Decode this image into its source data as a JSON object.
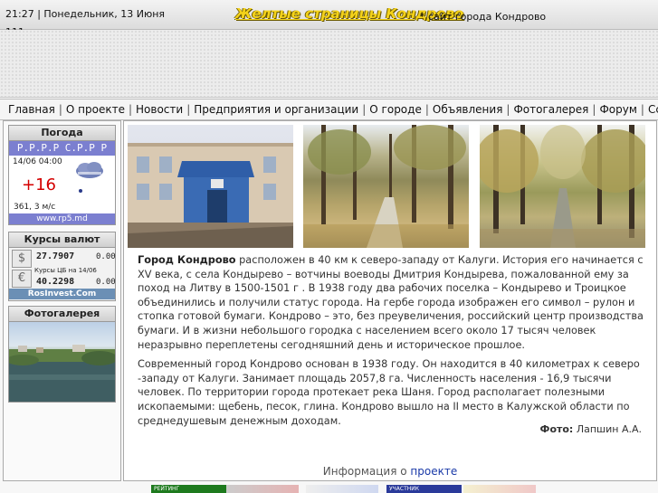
{
  "header": {
    "clock": "21:27 | Понедельник, 13 Июня 111",
    "logo": "Желтые страницы Кондрово",
    "tagline": "* сайт города Кондрово"
  },
  "nav": {
    "items": [
      "Главная",
      "О проекте",
      "Новости",
      "Предприятия и организации",
      "О городе",
      "Объявления",
      "Фотогалерея",
      "Форум",
      "Ссылки"
    ],
    "separator": "|"
  },
  "sidebar": {
    "weather": {
      "title": "Погода",
      "city": "Р.Р.Р.Р С.Р.Р Р",
      "date": "14/06 04:00",
      "temp": "+16",
      "wind": "361, 3 м/с",
      "site": "www.rp5.md"
    },
    "currency": {
      "title": "Курсы валют",
      "usd_symbol": "$",
      "usd_value": "27.7907",
      "usd_change": "0.00",
      "note": "Курсы ЦБ на   14/06",
      "eur_symbol": "€",
      "eur_value": "40.2298",
      "eur_change": "0.00",
      "site": "RosInvest.Com"
    },
    "gallery": {
      "title": "Фотогалерея"
    }
  },
  "main": {
    "lead": "Город Кондрово",
    "paragraph1": " расположен в 40 км к северо-западу от Калуги. История его начинается с XV века, с села Кондырево – вотчины воеводы Дмитрия Кондырева, пожалованной ему за поход на Литву в 1500-1501 г . В 1938 году два рабочих поселка – Кондырево и Троицкое объединились и получили статус города. На гербе города изображен его символ – рулон и стопка готовой бумаги. Кондрово – это, без преувеличения, российский центр производства бумаги. И в жизни небольшого городка с населением всего около 17 тысяч человек неразрывно переплетены сегодняшний день и историческое прошлое.",
    "paragraph2": "Современный город Кондрово основан в 1938 году. Он находится в 40 километрах к северо -западу от Калуги. Занимает площадь 2057,8 га. Численность населения - 16,9 тысячи человек. По территории города протекает река Шаня. Город располагает полезными ископаемыми: щебень, песок, глина. Кондрово вышло на II место в Калужской области по среднедушевым денежным доходам.",
    "photo_credit_label": "Фото:",
    "photo_credit_name": " Лапшин А.А.",
    "info_text": "Информация о ",
    "info_link": "проекте"
  },
  "footer": {
    "banner_text": "РЕЙТИНГ",
    "banner2_text": "УЧАСТНИК"
  }
}
